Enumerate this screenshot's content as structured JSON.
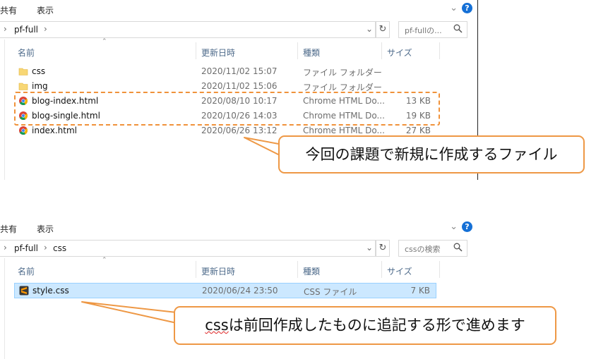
{
  "ribbon": {
    "share": "共有",
    "view": "表示",
    "help": "?"
  },
  "panel1": {
    "breadcrumb": [
      "pf-full"
    ],
    "search_placeholder": "pf-fullの...",
    "columns": {
      "name": "名前",
      "date": "更新日時",
      "type": "種類",
      "size": "サイズ"
    },
    "files": [
      {
        "name": "css",
        "date": "2020/11/02 15:07",
        "type": "ファイル フォルダー",
        "size": "",
        "icon": "folder-icon"
      },
      {
        "name": "img",
        "date": "2020/11/02 15:06",
        "type": "ファイル フォルダー",
        "size": "",
        "icon": "folder-icon"
      },
      {
        "name": "blog-index.html",
        "date": "2020/08/10 10:17",
        "type": "Chrome HTML Do...",
        "size": "13 KB",
        "icon": "chrome-icon"
      },
      {
        "name": "blog-single.html",
        "date": "2020/10/26 14:03",
        "type": "Chrome HTML Do...",
        "size": "19 KB",
        "icon": "chrome-icon"
      },
      {
        "name": "index.html",
        "date": "2020/06/26 13:12",
        "type": "Chrome HTML Do...",
        "size": "27 KB",
        "icon": "chrome-icon"
      }
    ]
  },
  "panel2": {
    "breadcrumb": [
      "pf-full",
      "css"
    ],
    "search_placeholder": "cssの検索",
    "columns": {
      "name": "名前",
      "date": "更新日時",
      "type": "種類",
      "size": "サイズ"
    },
    "files": [
      {
        "name": "style.css",
        "date": "2020/06/24 23:50",
        "type": "CSS ファイル",
        "size": "7 KB",
        "icon": "sublime-icon"
      }
    ]
  },
  "callouts": {
    "new_files": "今回の課題で新規に作成するファイル",
    "css_prefix": "css",
    "css_rest": "は前回作成したものに追記する形で進めます"
  },
  "colors": {
    "accent": "#f0923a",
    "selection": "#cce8ff",
    "help": "#1570d6"
  }
}
